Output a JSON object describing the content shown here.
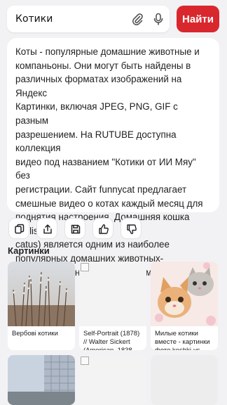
{
  "search": {
    "query": "Котики",
    "button": "Найти",
    "clip_icon": "paperclip-icon",
    "mic_icon": "microphone-icon"
  },
  "answer": {
    "text": "Коты - популярные домашние животные и\nкомпаньоны. Они могут быть найдены в\nразличных форматах изображений на Яндекс\nКартинки, включая JPEG, PNG, GIF с разным\nразрешением. На RUTUBE доступна коллекция\nвидео под названием \"Котики от ИИ Мяу\" без\nрегистрации. Сайт funnycat предлагает\nсмешные видео о котах каждый месяц для\nподнятия настроения. Домашняя кошка (Felis\ncatus) является одним из наиболее\nпопулярных домашних животных-\nкомпаньонов наряду с собаками."
  },
  "actions": [
    "copy-icon",
    "share-icon",
    "save-icon",
    "thumbs-up-icon",
    "thumbs-down-icon"
  ],
  "images_section": {
    "title": "Картинки",
    "items": [
      {
        "caption": "Вербові котики"
      },
      {
        "caption": "Self-Portrait (1878) // Walter Sickert (American, 1838"
      },
      {
        "caption": "Милые котики вместе - картинки фото koshki-vs"
      },
      {
        "caption": ""
      },
      {
        "caption": ""
      },
      {
        "caption": ""
      }
    ]
  },
  "colors": {
    "accent": "#d9272e",
    "background": "#f2f2f4",
    "card": "#ffffff"
  }
}
